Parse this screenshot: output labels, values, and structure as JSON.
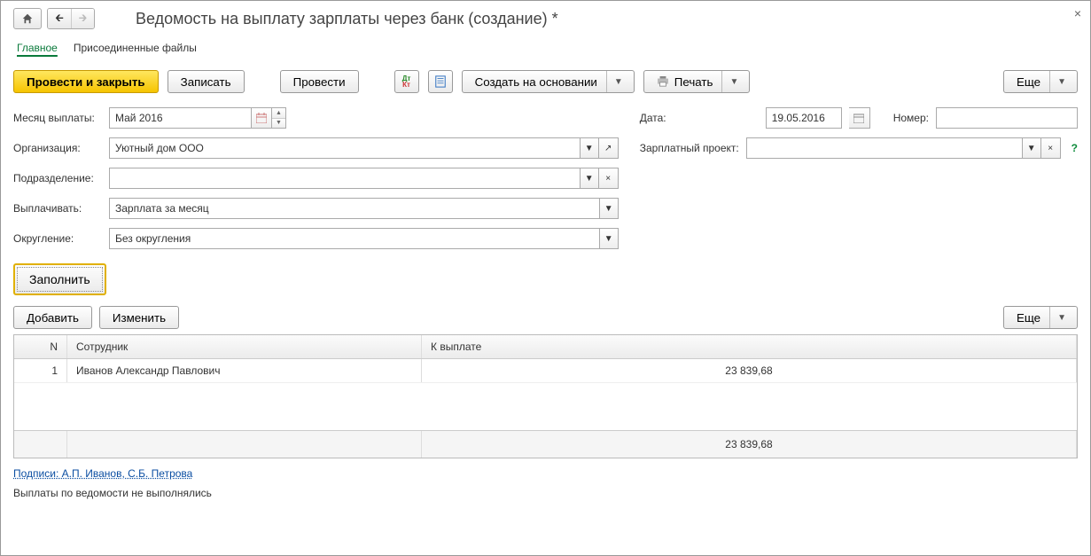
{
  "title": "Ведомость на выплату зарплаты через банк (создание) *",
  "tabs": {
    "main": "Главное",
    "files": "Присоединенные файлы"
  },
  "toolbar": {
    "post_close": "Провести и закрыть",
    "write": "Записать",
    "post": "Провести",
    "create_based": "Создать на основании",
    "print": "Печать",
    "more": "Еще"
  },
  "labels": {
    "month": "Месяц выплаты:",
    "org": "Организация:",
    "dept": "Подразделение:",
    "pay": "Выплачивать:",
    "round": "Округление:",
    "date": "Дата:",
    "number": "Номер:",
    "project": "Зарплатный проект:"
  },
  "values": {
    "month": "Май 2016",
    "org": "Уютный дом ООО",
    "dept": "",
    "pay": "Зарплата за месяц",
    "round": "Без округления",
    "date": "19.05.2016",
    "number": "",
    "project": ""
  },
  "fill": "Заполнить",
  "tableToolbar": {
    "add": "Добавить",
    "edit": "Изменить",
    "more": "Еще"
  },
  "table": {
    "headers": {
      "n": "N",
      "emp": "Сотрудник",
      "amt": "К выплате"
    },
    "rows": [
      {
        "n": "1",
        "emp": "Иванов Александр Павлович",
        "amt": "23 839,68"
      }
    ],
    "total": "23 839,68"
  },
  "signatures": "Подписи: А.П. Иванов, С.Б. Петрова",
  "status": "Выплаты по ведомости не выполнялись"
}
